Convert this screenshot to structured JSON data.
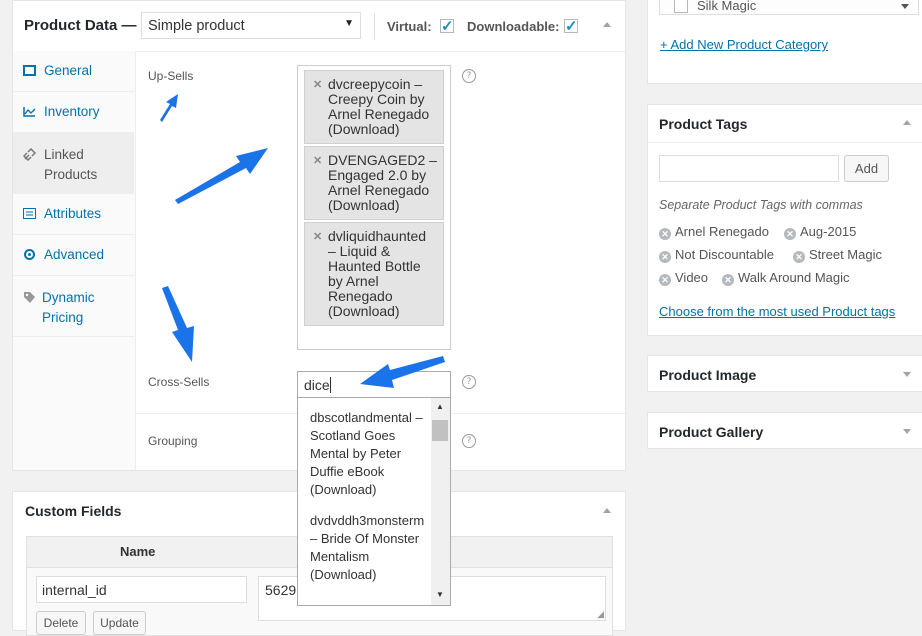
{
  "product_data": {
    "title": "Product Data —",
    "type_select": "Simple product",
    "virtual_label": "Virtual:",
    "downloadable_label": "Downloadable:"
  },
  "tabs": [
    {
      "label": "General",
      "icon": "grid-icon"
    },
    {
      "label": "Inventory",
      "icon": "chart-line-icon"
    },
    {
      "label": "Linked Products",
      "icon": "link-icon"
    },
    {
      "label": "Attributes",
      "icon": "list-icon"
    },
    {
      "label": "Advanced",
      "icon": "gear-icon"
    },
    {
      "label": "Dynamic Pricing",
      "icon": "tag-icon"
    }
  ],
  "linked": {
    "upsells_label": "Up-Sells",
    "upsells": [
      "dvcreepycoin – Creepy Coin by Arnel Renegado (Download)",
      "DVENGAGED2 – Engaged 2.0 by Arnel Renegado (Download)",
      "dvliquidhaunted – Liquid & Haunted Bottle by Arnel Renegado (Download)"
    ],
    "crosssells_label": "Cross-Sells",
    "crosssells_value": "dice",
    "dropdown_results": [
      "dbscotlandmental – Scotland Goes Mental by Peter Duffie eBook (Download)",
      "dvdvddh3monsterm – Bride Of Monster Mentalism (Download)"
    ],
    "grouping_label": "Grouping",
    "help_glyph": "?"
  },
  "custom_fields": {
    "title": "Custom Fields",
    "name_header": "Name",
    "name_value": "internal_id",
    "value_text": "5629",
    "delete_label": "Delete",
    "update_label": "Update"
  },
  "sidebar": {
    "category_item": "Silk Magic",
    "add_category_link": "+ Add New Product Category",
    "tags_title": "Product Tags",
    "add_button": "Add",
    "tags_hint": "Separate Product Tags with commas",
    "tags": [
      "Arnel Renegado",
      "Aug-2015",
      "Not Discountable",
      "Street Magic",
      "Video",
      "Walk Around Magic"
    ],
    "choose_tags_link": "Choose from the most used Product tags",
    "image_title": "Product Image",
    "gallery_title": "Product Gallery"
  },
  "colors": {
    "link": "#0073aa",
    "arrow": "#1a73e8",
    "chip": "#e4e4e4"
  }
}
